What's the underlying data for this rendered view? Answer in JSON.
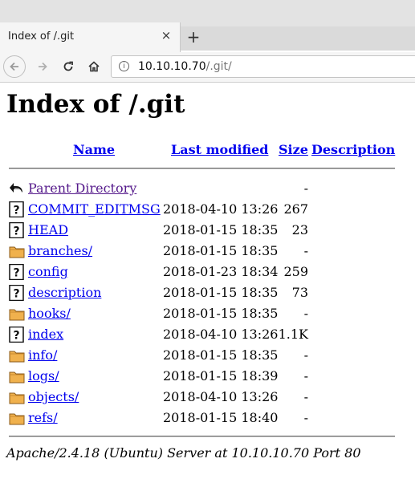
{
  "browser": {
    "tab_title": "Index of /.git",
    "tab_close": "×",
    "new_tab": "+",
    "url_host": "10.10.10.70",
    "url_path": "/.git/"
  },
  "page": {
    "title": "Index of /.git",
    "columns": {
      "name": "Name",
      "last_modified": "Last modified",
      "size": "Size",
      "description": "Description"
    },
    "rows": [
      {
        "icon": "back-icon",
        "name": "Parent Directory",
        "date": "",
        "size": "-"
      },
      {
        "icon": "unknown-file-icon",
        "name": "COMMIT_EDITMSG",
        "date": "2018-04-10 13:26",
        "size": "267"
      },
      {
        "icon": "unknown-file-icon",
        "name": "HEAD",
        "date": "2018-01-15 18:35",
        "size": "23"
      },
      {
        "icon": "folder-icon",
        "name": "branches/",
        "date": "2018-01-15 18:35",
        "size": "-"
      },
      {
        "icon": "unknown-file-icon",
        "name": "config",
        "date": "2018-01-23 18:34",
        "size": "259"
      },
      {
        "icon": "unknown-file-icon",
        "name": "description",
        "date": "2018-01-15 18:35",
        "size": "73"
      },
      {
        "icon": "folder-icon",
        "name": "hooks/",
        "date": "2018-01-15 18:35",
        "size": "-"
      },
      {
        "icon": "unknown-file-icon",
        "name": "index",
        "date": "2018-04-10 13:26",
        "size": "1.1K"
      },
      {
        "icon": "folder-icon",
        "name": "info/",
        "date": "2018-01-15 18:35",
        "size": "-"
      },
      {
        "icon": "folder-icon",
        "name": "logs/",
        "date": "2018-01-15 18:39",
        "size": "-"
      },
      {
        "icon": "folder-icon",
        "name": "objects/",
        "date": "2018-04-10 13:26",
        "size": "-"
      },
      {
        "icon": "folder-icon",
        "name": "refs/",
        "date": "2018-01-15 18:40",
        "size": "-"
      }
    ],
    "footer": "Apache/2.4.18 (Ubuntu) Server at 10.10.10.70 Port 80"
  },
  "colors": {
    "link": "#0000ee",
    "visited_link": "#551a8b",
    "folder": "#f0b14d"
  }
}
